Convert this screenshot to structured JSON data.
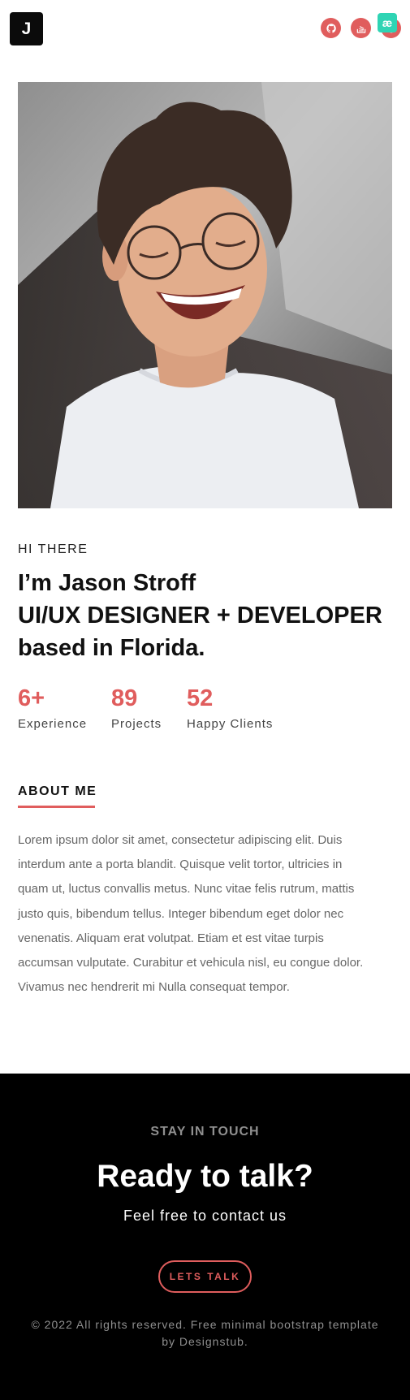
{
  "header": {
    "logo_letter": "J",
    "social_icons": [
      "github-icon",
      "stackoverflow-icon",
      "dribbble-icon"
    ],
    "extension_badge": "æ"
  },
  "hero": {
    "greeting": "HI THERE",
    "headline_lines": [
      "I’m Jason Stroff",
      "UI/UX DESIGNER + DEVELOPER",
      "based in Florida."
    ]
  },
  "stats": [
    {
      "value": "6+",
      "label": "Experience"
    },
    {
      "value": "89",
      "label": "Projects"
    },
    {
      "value": "52",
      "label": "Happy Clients"
    }
  ],
  "about": {
    "title": "ABOUT ME",
    "body_lines": [
      "Lorem ipsum dolor sit amet, consectetur adipiscing elit. Duis",
      "interdum ante a porta blandit. Quisque velit tortor, ultricies in",
      "quam ut, luctus convallis metus. Nunc vitae felis rutrum, mattis",
      "justo quis, bibendum tellus. Integer bibendum eget dolor nec",
      "venenatis. Aliquam erat volutpat. Etiam et est vitae turpis",
      "accumsan vulputate. Curabitur et vehicula nisl, eu congue dolor.",
      "Vivamus nec hendrerit mi Nulla consequat tempor."
    ]
  },
  "footer": {
    "kicker": "STAY IN TOUCH",
    "title": "Ready to talk?",
    "subtitle": "Feel free to contact us",
    "cta_label": "LETS TALK",
    "copyright_lines": [
      "© 2022 All rights reserved. Free minimal bootstrap template",
      "by Designstub."
    ]
  },
  "colors": {
    "accent": "#e05d5d",
    "footer_bg": "#000000",
    "badge": "#2fd4b4"
  }
}
